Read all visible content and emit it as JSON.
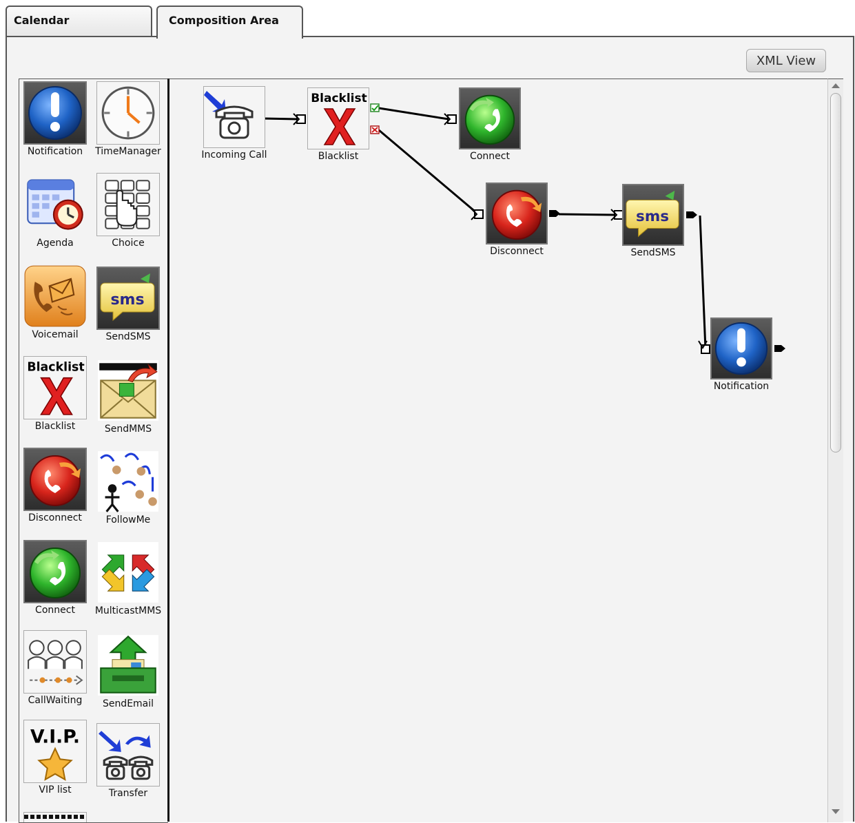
{
  "tabs": [
    {
      "label": "Calendar"
    },
    {
      "label": "Composition Area"
    }
  ],
  "toolbar": {
    "xml_view_label": "XML View"
  },
  "palette": {
    "items": [
      {
        "label": "Notification",
        "icon": "notification-icon"
      },
      {
        "label": "TimeManager",
        "icon": "clock-icon"
      },
      {
        "label": "Agenda",
        "icon": "calendar-icon"
      },
      {
        "label": "Choice",
        "icon": "keypad-icon"
      },
      {
        "label": "Voicemail",
        "icon": "voicemail-icon"
      },
      {
        "label": "SendSMS",
        "icon": "sms-icon"
      },
      {
        "label": "Blacklist",
        "icon": "blacklist-icon",
        "badge": "Blacklist"
      },
      {
        "label": "SendMMS",
        "icon": "mms-icon"
      },
      {
        "label": "Disconnect",
        "icon": "disconnect-icon"
      },
      {
        "label": "FollowMe",
        "icon": "followme-icon"
      },
      {
        "label": "Connect",
        "icon": "connect-icon"
      },
      {
        "label": "MulticastMMS",
        "icon": "multicast-icon"
      },
      {
        "label": "CallWaiting",
        "icon": "call-waiting-icon"
      },
      {
        "label": "SendEmail",
        "icon": "send-email-icon"
      },
      {
        "label": "VIP list",
        "icon": "vip-icon",
        "badge": "V.I.P."
      },
      {
        "label": "Transfer",
        "icon": "transfer-icon"
      }
    ]
  },
  "canvas": {
    "nodes": [
      {
        "label": "Incoming Call",
        "icon": "incoming-call-icon"
      },
      {
        "label": "Blacklist",
        "icon": "blacklist-icon",
        "badge": "Blacklist"
      },
      {
        "label": "Connect",
        "icon": "connect-icon"
      },
      {
        "label": "Disconnect",
        "icon": "disconnect-icon"
      },
      {
        "label": "SendSMS",
        "icon": "sms-icon"
      },
      {
        "label": "Notification",
        "icon": "notification-icon"
      }
    ]
  },
  "colors": {
    "accent_blue": "#1f63c6",
    "danger_red": "#d8251c",
    "success_green": "#2fb52c",
    "sms_text": "#2a2a8a"
  }
}
